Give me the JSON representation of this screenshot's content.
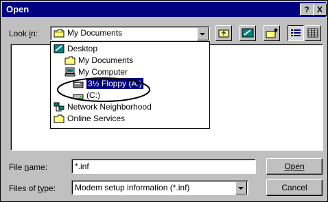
{
  "title": "Open",
  "title_buttons": {
    "help": "?",
    "close": "X"
  },
  "lookin": {
    "label": "Look in:",
    "value": "My Documents"
  },
  "dropdown_items": [
    {
      "label": "Desktop",
      "icon": "desktop-icon"
    },
    {
      "label": "My Documents",
      "icon": "folder-icon"
    },
    {
      "label": "My Computer",
      "icon": "computer-icon"
    },
    {
      "label": "3½ Floppy (A:)",
      "icon": "floppy-icon",
      "selected": true
    },
    {
      "label": "(C:)",
      "icon": "drive-icon"
    },
    {
      "label": "Network Neighborhood",
      "icon": "network-icon"
    },
    {
      "label": "Online Services",
      "icon": "folder-icon"
    }
  ],
  "filename": {
    "label": "File name:",
    "value": "*.inf"
  },
  "filetype": {
    "label": "Files of type:",
    "value": "Modem setup information (*.inf)"
  },
  "buttons": {
    "open": "Open",
    "cancel": "Cancel"
  },
  "colors": {
    "titlebar": "#000080",
    "face": "#c0c0c0",
    "highlight": "#000080"
  }
}
